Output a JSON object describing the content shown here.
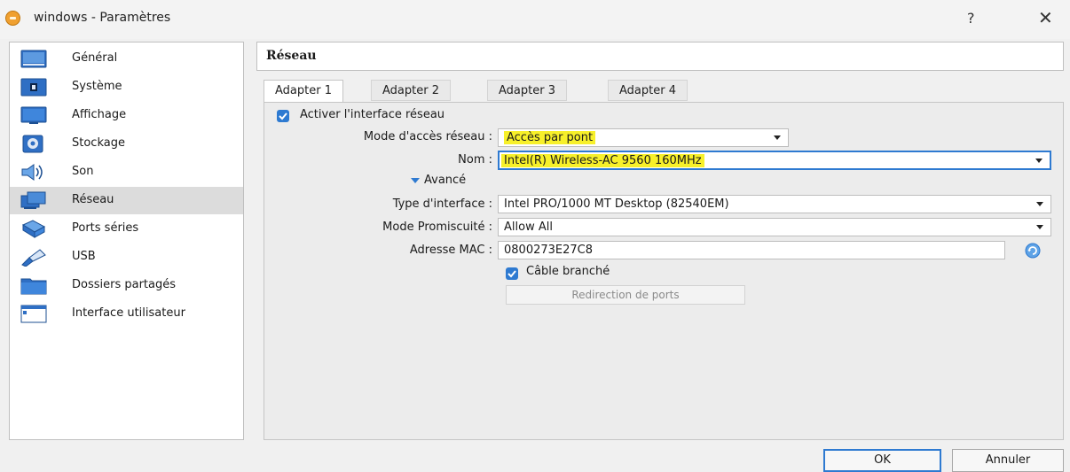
{
  "window": {
    "title": "windows - Paramètres",
    "help_label": "?",
    "close_label": "✕"
  },
  "sidebar": {
    "items": [
      {
        "label": "Général",
        "icon": "general-icon"
      },
      {
        "label": "Système",
        "icon": "chip-icon"
      },
      {
        "label": "Affichage",
        "icon": "monitor-icon"
      },
      {
        "label": "Stockage",
        "icon": "disk-icon"
      },
      {
        "label": "Son",
        "icon": "speaker-icon"
      },
      {
        "label": "Réseau",
        "icon": "network-icon"
      },
      {
        "label": "Ports séries",
        "icon": "serial-port-icon"
      },
      {
        "label": "USB",
        "icon": "usb-icon"
      },
      {
        "label": "Dossiers partagés",
        "icon": "folder-icon"
      },
      {
        "label": "Interface utilisateur",
        "icon": "ui-window-icon"
      }
    ],
    "selected": "Réseau"
  },
  "main": {
    "title": "Réseau",
    "tabs": [
      {
        "label": "Adapter 1"
      },
      {
        "label": "Adapter 2"
      },
      {
        "label": "Adapter 3"
      },
      {
        "label": "Adapter 4"
      }
    ],
    "active_tab": "Adapter 1",
    "enable_label": "Activer l'interface réseau",
    "enable_checked": true,
    "fields": {
      "mode_label": "Mode d'accès réseau :",
      "mode_value": "Accès par pont",
      "name_label": "Nom :",
      "name_value": "Intel(R) Wireless-AC 9560 160MHz",
      "advanced_label": "Avancé",
      "type_label": "Type d'interface :",
      "type_value": "Intel PRO/1000 MT Desktop (82540EM)",
      "promisc_label": "Mode Promiscuité :",
      "promisc_value": "Allow All",
      "mac_label": "Adresse MAC :",
      "mac_value": "0800273E27C8",
      "cable_label": "Câble branché",
      "cable_checked": true,
      "port_forward_label": "Redirection de ports"
    }
  },
  "footer": {
    "ok_label": "OK",
    "cancel_label": "Annuler"
  },
  "colors": {
    "accent": "#2e7ad1",
    "highlight": "#f7f02a",
    "selected_row": "#dcdcdc"
  }
}
